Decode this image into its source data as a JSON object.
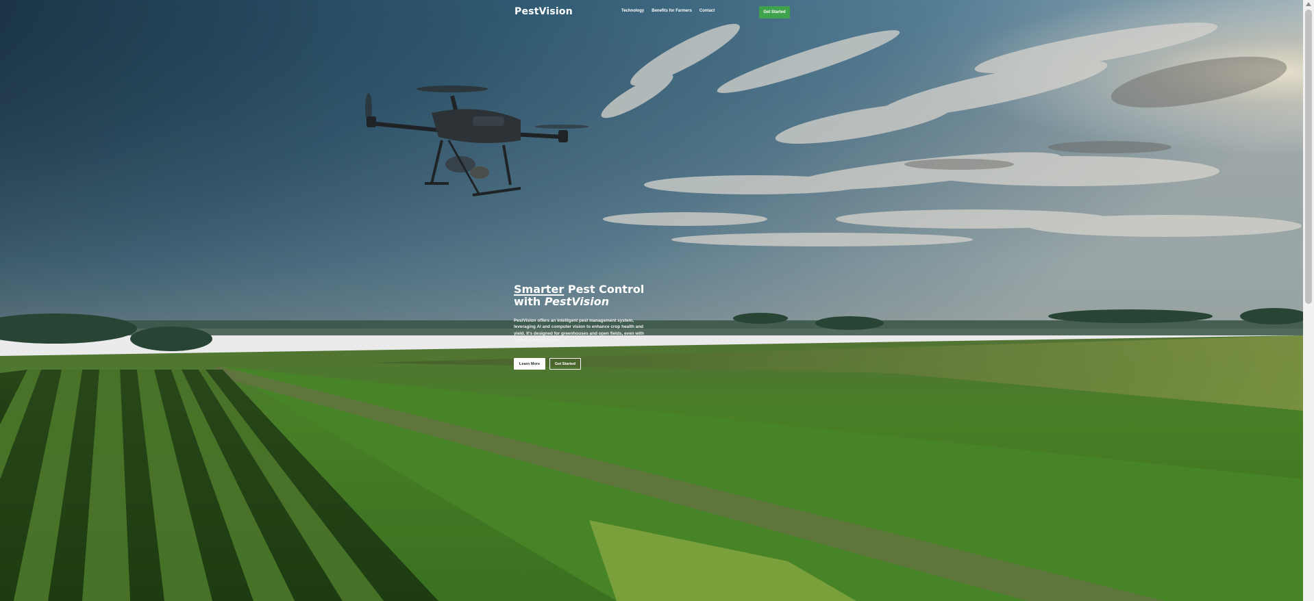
{
  "nav": {
    "logo": "PestVision",
    "links": [
      "Technology",
      "Benefits for Farmers",
      "Contact"
    ],
    "cta_label": "Get Started",
    "cta_color": "#3fa34d"
  },
  "hero": {
    "title_underlined": "Smarter",
    "title_rest": " Pest Control",
    "title_line2_prefix": "with ",
    "title_line2_brand": "PestVision",
    "description": "PestVision offers an intelligent pest management system, leveraging AI and computer vision to enhance crop health and yield. It's designed for greenhouses and open fields, even with limited internet access.",
    "primary_button": "Learn More",
    "secondary_button": "Get Started"
  },
  "background": {
    "scene": "drone-over-farm-fields",
    "sky_color": "#3d6a84",
    "field_color": "#4e8a2c"
  }
}
